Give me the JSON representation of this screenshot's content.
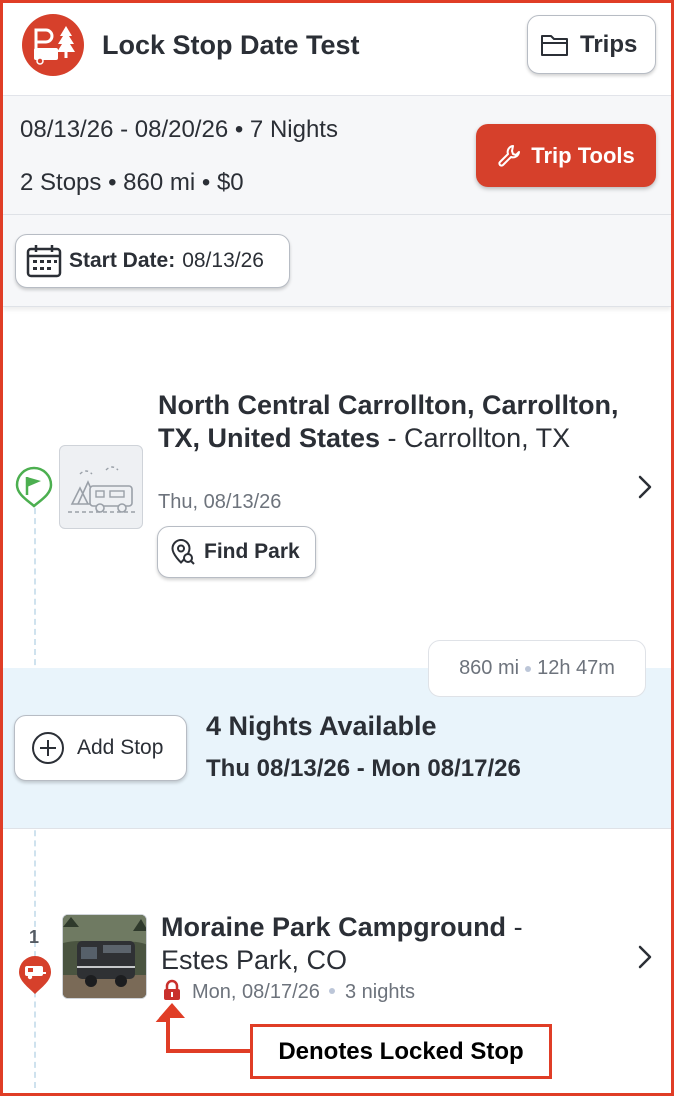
{
  "header": {
    "trip_title": "Lock Stop Date Test",
    "trips_label": "Trips"
  },
  "summary": {
    "date_range": "08/13/26 - 08/20/26",
    "nights": "7 Nights",
    "stops": "2 Stops",
    "distance": "860 mi",
    "cost": "$0",
    "separator": "•",
    "trip_tools_label": "Trip Tools",
    "start_date_label": "Start Date:",
    "start_date_value": "08/13/26"
  },
  "stops": [
    {
      "name": "North Central Carrollton, Carrollton, TX, United States",
      "dash": " - ",
      "city": "Carrollton, TX",
      "date": "Thu, 08/13/26",
      "find_park_label": "Find Park"
    },
    {
      "number": "1",
      "name": "Moraine Park Campground",
      "dash": " - ",
      "city": "Estes Park, CO",
      "date": "Mon, 08/17/26",
      "nights": "3 nights"
    }
  ],
  "drive": {
    "distance": "860 mi",
    "duration": "12h 47m"
  },
  "availability": {
    "add_stop_label": "Add Stop",
    "title": "4 Nights Available",
    "range": "Thu 08/13/26 - Mon 08/17/26"
  },
  "annotation": {
    "text": "Denotes Locked Stop"
  },
  "colors": {
    "brand_red": "#d6402b",
    "annotation_red": "#e03d26",
    "start_pin_green": "#4caf50",
    "availability_band": "#e9f4fb"
  },
  "icons": [
    "logo",
    "folder-icon",
    "wrench-icon",
    "calendar-icon",
    "start-flag-pin-icon",
    "camper-placeholder-icon",
    "location-search-icon",
    "chevron-right-icon",
    "add-circle-icon",
    "rv-pin-icon",
    "lock-icon"
  ]
}
